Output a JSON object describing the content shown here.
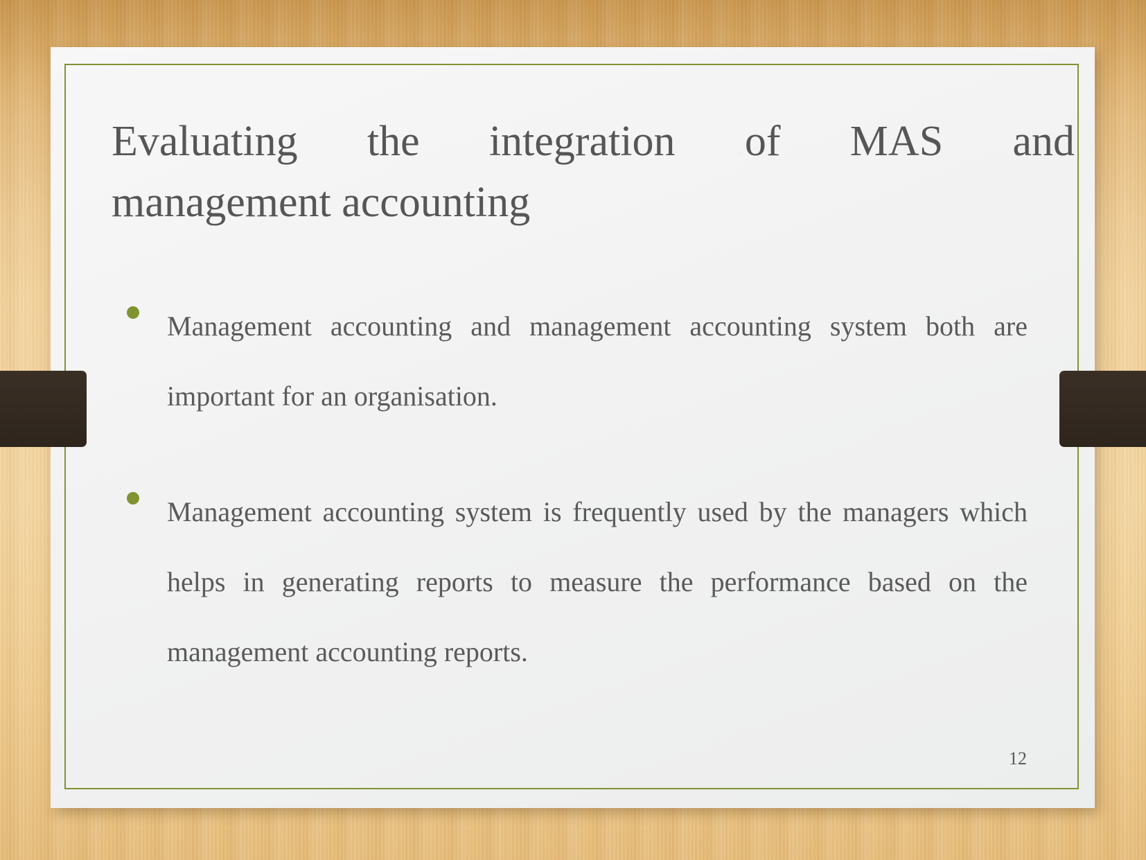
{
  "slide": {
    "title_line_1": "Evaluating the integration of MAS and",
    "title_line_2": "management accounting",
    "title_full": "Evaluating the integration of MAS and management accounting",
    "page_number": "12",
    "bullets": [
      {
        "text": "Management accounting and management accounting system both are important for an organisation."
      },
      {
        "text": "Management accounting system is frequently used by the managers which helps in generating reports to measure the performance based on the management accounting reports."
      }
    ],
    "colors": {
      "accent_olive": "#7f9431",
      "ribbon_dark": "#342a21",
      "text_gray": "#5a5a5a",
      "title_gray": "#565656",
      "panel_bg": "#f2f2f2",
      "wood_background": "#e8bd78"
    }
  }
}
